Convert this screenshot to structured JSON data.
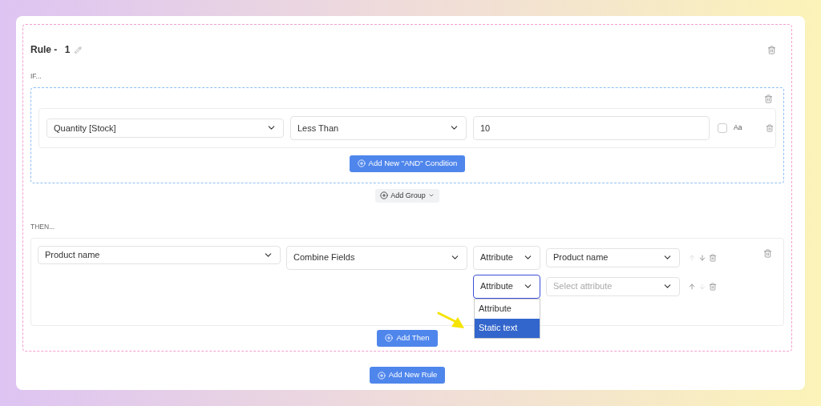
{
  "rule": {
    "title": "Rule - ",
    "number": "1"
  },
  "if": {
    "label": "IF...",
    "conditions": [
      {
        "field": "Quantity [Stock]",
        "operator": "Less Than",
        "value": "10",
        "case_sensitive": false,
        "case_label": "Aa"
      }
    ],
    "add_condition": "Add New \"AND\" Condition",
    "add_group": "Add Group"
  },
  "then": {
    "label": "THEN...",
    "actions": [
      {
        "field": "Product name",
        "action": "Combine Fields",
        "parts": [
          {
            "type": "Attribute",
            "value": "Product name",
            "focused": false,
            "up_disabled": true,
            "down_disabled": false
          },
          {
            "type": "Attribute",
            "placeholder": "Select attribute",
            "focused": true,
            "up_disabled": false,
            "down_disabled": true,
            "menu": [
              {
                "label": "Attribute",
                "selected": false
              },
              {
                "label": "Static text",
                "selected": true
              }
            ]
          }
        ]
      }
    ],
    "add_then": "Add Then"
  },
  "add_rule": "Add New Rule"
}
